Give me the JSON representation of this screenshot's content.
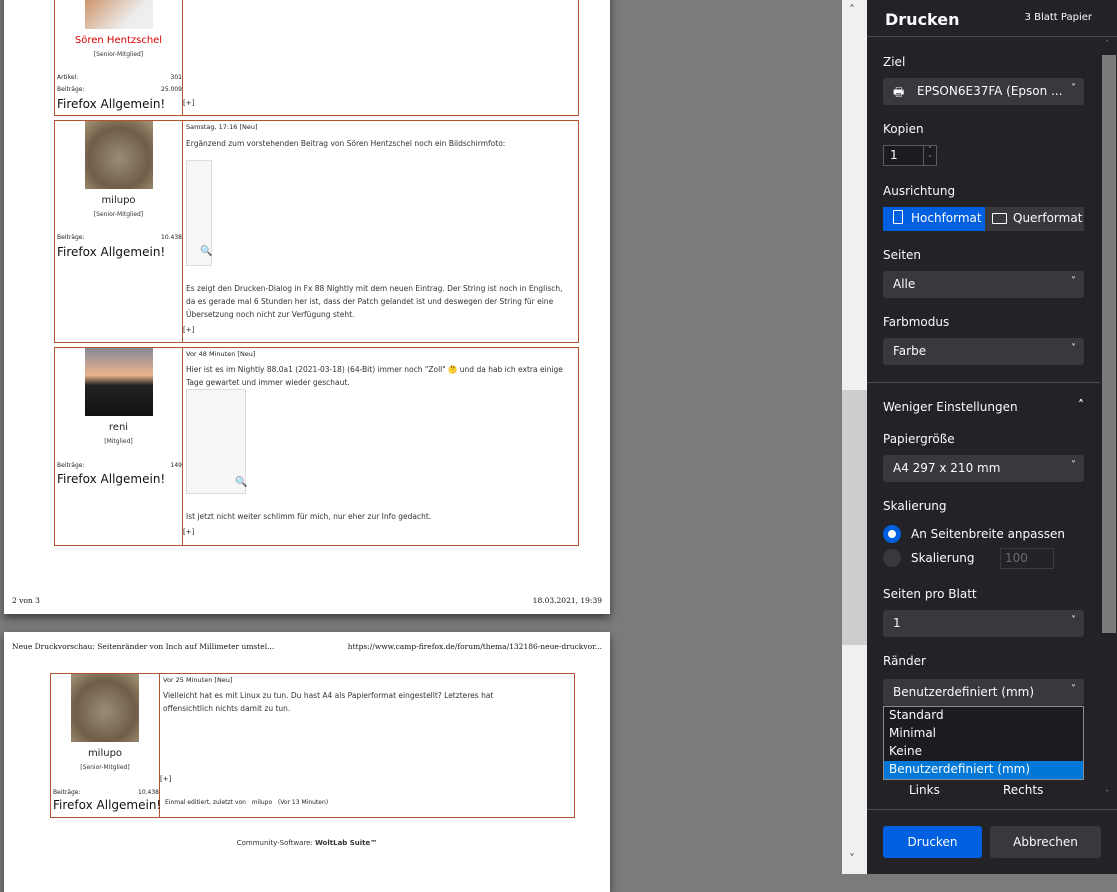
{
  "preview": {
    "page1": {
      "posts": [
        {
          "name": "Sören Hentzschel",
          "rank": "[Senior-Mitglied]",
          "stats": [
            {
              "k": "Artikel:",
              "v": "301"
            },
            {
              "k": "Beiträge:",
              "v": "25.009"
            }
          ],
          "signature": "Firefox Allgemein!",
          "plus": "[+]"
        },
        {
          "name": "milupo",
          "rank": "[Senior-Mitglied]",
          "stats": [
            {
              "k": "Beiträge:",
              "v": "10.438"
            }
          ],
          "signature": "Firefox Allgemein!",
          "time": "Samstag, 17:16",
          "new": "[Neu]",
          "text1": "Ergänzend zum vorstehenden Beitrag von Sören Hentzschel noch ein Bildschirmfoto:",
          "text2": "Es zeigt den Drucken-Dialog in Fx 88 Nightly mit dem neuen Eintrag. Der String ist noch in Englisch, da es gerade mal 6 Stunden her ist, dass der Patch gelandet ist und deswegen der String für eine Übersetzung noch nicht zur Verfügung steht.",
          "plus": "[+]"
        },
        {
          "name": "reni",
          "rank": "[Mitglied]",
          "stats": [
            {
              "k": "Beiträge:",
              "v": "149"
            }
          ],
          "signature": "Firefox Allgemein!",
          "time": "Vor 48 Minuten",
          "new": "[Neu]",
          "text1": "Hier ist es im Nightly 88.0a1 (2021-03-18) (64-Bit) immer noch \"Zoll\" 🤔 und da hab ich extra einige Tage gewartet und immer wieder geschaut.",
          "text2": "Ist jetzt nicht weiter schlimm für mich, nur eher zur Info gedacht.",
          "plus": "[+]"
        }
      ],
      "footer_left": "2 von 3",
      "footer_right": "18.03.2021, 19:39"
    },
    "page2": {
      "header_left": "Neue Druckvorschau: Seitenränder von Inch auf Millimeter umstel...",
      "header_right": "https://www.camp-firefox.de/forum/thema/132186-neue-druckvor...",
      "post": {
        "name": "milupo",
        "rank": "[Senior-Mitglied]",
        "stats": [
          {
            "k": "Beiträge:",
            "v": "10.438"
          }
        ],
        "signature": "Firefox Allgemein!",
        "time": "Vor 25 Minuten",
        "new": "[Neu]",
        "text1": "Vielleicht hat es mit Linux zu tun. Du hast A4 als Papierformat eingestellt? Letzteres hat offensichtlich nichts damit zu tun.",
        "plus": "[+]",
        "edited": "Einmal editiert, zuletzt von",
        "edited_by": "milupo",
        "edited_when": "(Vor 13 Minuten)"
      },
      "footer_prefix": "Community-Software: ",
      "footer_brand": "WoltLab Suite™"
    }
  },
  "panel": {
    "title": "Drucken",
    "sheets": "3 Blatt Papier",
    "ziel_label": "Ziel",
    "ziel_value": "EPSON6E37FA (Epson ...",
    "kopien_label": "Kopien",
    "kopien_value": "1",
    "ausrichtung_label": "Ausrichtung",
    "hochformat": "Hochformat",
    "querformat": "Querformat",
    "seiten_label": "Seiten",
    "seiten_value": "Alle",
    "farbmodus_label": "Farbmodus",
    "farbmodus_value": "Farbe",
    "weniger": "Weniger Einstellungen",
    "papier_label": "Papiergröße",
    "papier_value": "A4 297 x 210 mm",
    "skalierung_label": "Skalierung",
    "fit_label": "An Seitenbreite anpassen",
    "scale_label": "Skalierung",
    "scale_value": "100",
    "ppb_label": "Seiten pro Blatt",
    "ppb_value": "1",
    "raender_label": "Ränder",
    "raender_value": "Benutzerdefiniert (mm)",
    "raender_options": [
      "Standard",
      "Minimal",
      "Keine",
      "Benutzerdefiniert (mm)"
    ],
    "links": "Links",
    "rechts": "Rechts",
    "print": "Drucken",
    "cancel": "Abbrechen",
    "accent": "#0060df",
    "selected_option": "#0078d7"
  }
}
